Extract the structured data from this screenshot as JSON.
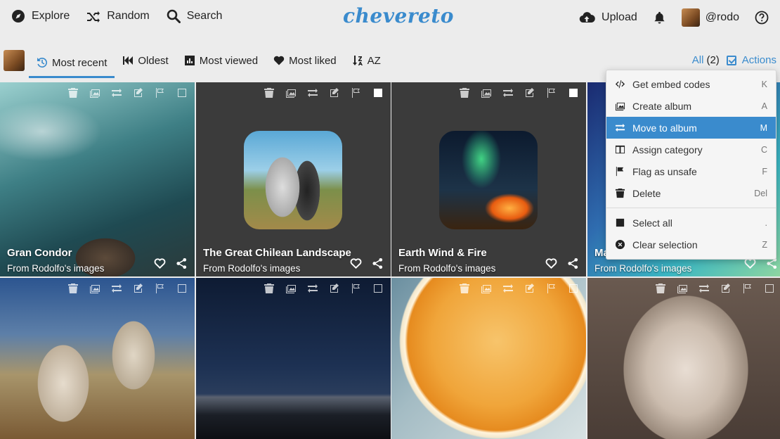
{
  "topnav": {
    "explore": "Explore",
    "random": "Random",
    "search": "Search",
    "logo": "chevereto",
    "upload": "Upload",
    "username": "@rodo"
  },
  "tabs": [
    {
      "label": "Most recent",
      "icon": "history-icon",
      "active": true
    },
    {
      "label": "Oldest",
      "icon": "fast-backward-icon"
    },
    {
      "label": "Most viewed",
      "icon": "bar-chart-icon"
    },
    {
      "label": "Most liked",
      "icon": "heart-icon"
    },
    {
      "label": "AZ",
      "icon": "sort-alpha-icon"
    }
  ],
  "selection": {
    "all_label": "All",
    "count": "(2)",
    "actions_label": "Actions"
  },
  "menu": {
    "items": [
      {
        "label": "Get embed codes",
        "key": "K",
        "icon": "code-icon"
      },
      {
        "label": "Create album",
        "key": "A",
        "icon": "images-icon"
      },
      {
        "label": "Move to album",
        "key": "M",
        "icon": "exchange-icon",
        "active": true
      },
      {
        "label": "Assign category",
        "key": "C",
        "icon": "columns-icon"
      },
      {
        "label": "Flag as unsafe",
        "key": "F",
        "icon": "flag-icon"
      },
      {
        "label": "Delete",
        "key": "Del",
        "icon": "trash-icon"
      }
    ],
    "items2": [
      {
        "label": "Select all",
        "key": ".",
        "icon": "check-square-icon"
      },
      {
        "label": "Clear selection",
        "key": "Z",
        "icon": "times-circle-icon"
      }
    ]
  },
  "images": [
    {
      "title": "Gran Condor",
      "subtitle": "From Rodolfo's images",
      "selected": false
    },
    {
      "title": "The Great Chilean Landscape",
      "subtitle": "From Rodolfo's images",
      "selected": true
    },
    {
      "title": "Earth Wind & Fire",
      "subtitle": "From Rodolfo's images",
      "selected": true
    },
    {
      "title": "Ma",
      "subtitle": "From Rodolfo's images",
      "selected": false
    },
    {
      "title": "",
      "subtitle": "",
      "selected": false
    },
    {
      "title": "",
      "subtitle": "",
      "selected": false
    },
    {
      "title": "",
      "subtitle": "",
      "selected": false
    },
    {
      "title": "",
      "subtitle": "",
      "selected": false
    }
  ],
  "colors": {
    "accent": "#3a8bcd",
    "dark_tile": "#3b3b3b"
  }
}
